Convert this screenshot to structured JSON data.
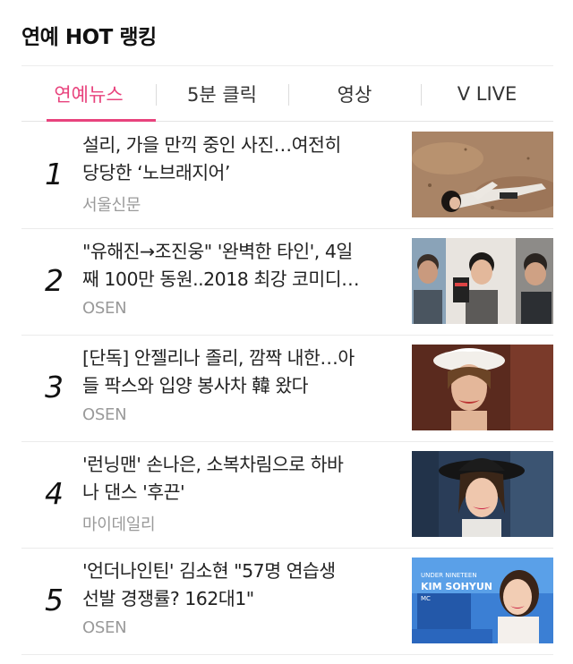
{
  "header": {
    "title": "연예 HOT 랭킹"
  },
  "tabs": [
    {
      "label": "연예뉴스",
      "active": true
    },
    {
      "label": "5분 클릭",
      "active": false
    },
    {
      "label": "영상",
      "active": false
    },
    {
      "label": "V LIVE",
      "active": false
    }
  ],
  "articles": [
    {
      "rank": "1",
      "title_lines": [
        "설리, 가을 만끽 중인 사진…여전히",
        "당당한 ‘노브래지어’"
      ],
      "source": "서울신문"
    },
    {
      "rank": "2",
      "title_lines": [
        "\"유해진→조진웅\" '완벽한 타인', 4일",
        "째 100만 동원..2018 최강 코미디…"
      ],
      "source": "OSEN"
    },
    {
      "rank": "3",
      "title_lines": [
        "[단독] 안젤리나 졸리, 깜짝 내한…아",
        "들 팍스와 입양 봉사차 韓 왔다"
      ],
      "source": "OSEN"
    },
    {
      "rank": "4",
      "title_lines": [
        "'런닝맨' 손나은, 소복차림으로 하바",
        "나 댄스 '후끈'"
      ],
      "source": "마이데일리"
    },
    {
      "rank": "5",
      "title_lines": [
        "'언더나인틴' 김소현 \"57명 연습생",
        "선발 경쟁률? 162대1\""
      ],
      "source": "OSEN"
    }
  ],
  "thumb5_caption": {
    "line1": "UNDER NINETEEN",
    "line2": "KIM SOHYUN",
    "line3": "MC"
  }
}
